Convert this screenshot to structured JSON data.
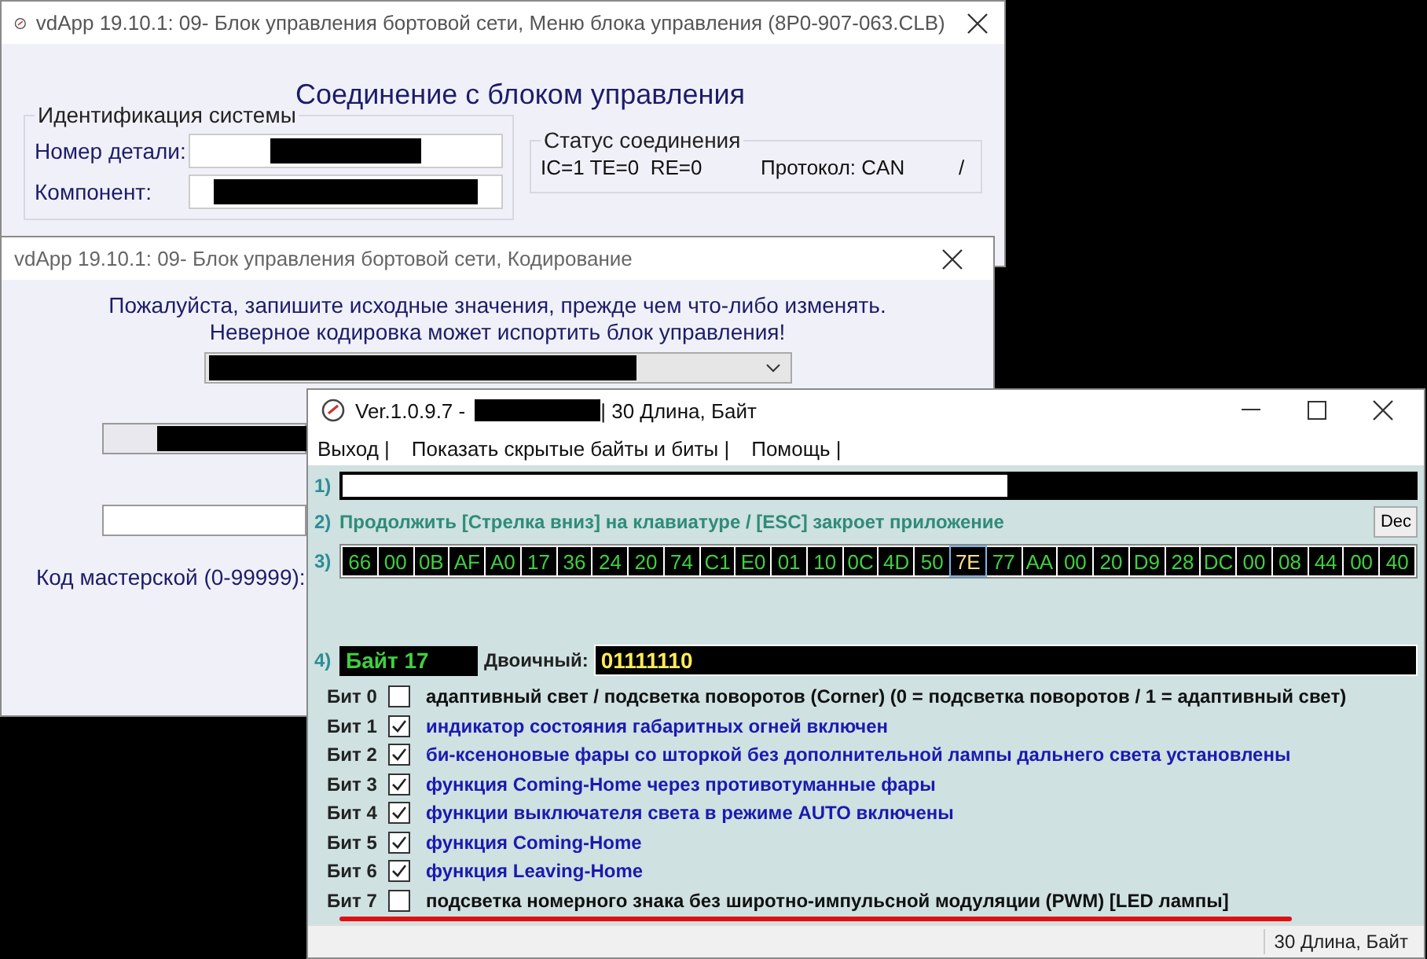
{
  "main_window": {
    "title": "vdApp 19.10.1: 09- Блок управления бортовой сети,  Меню блока управления (8P0-907-063.CLB)",
    "heading": "Соединение с блоком управления",
    "identification": {
      "title": "Идентификация системы",
      "fields": [
        {
          "label": "Номер детали:"
        },
        {
          "label": "Компонент:"
        }
      ]
    },
    "connection_status": {
      "title": "Статус соединения",
      "counters": "IC=1 TE=0  RE=0",
      "protocol": "Протокол: CAN",
      "indicator": "/"
    }
  },
  "coding_window": {
    "title": "vdApp 19.10.1: 09- Блок управления бортовой сети,  Кодирование",
    "notice_lines": [
      "Пожалуйста, запишите исходные значения, прежде чем что-либо изменять.",
      "Неверное кодировка может испортить блок управления!"
    ],
    "workshop_code_label": "Код мастерской (0-99999):"
  },
  "editor_window": {
    "title_prefix": "Ver.1.0.9.7 -",
    "title_suffix": "| 30 Длина, Байт",
    "menu": [
      "Выход |",
      "Показать скрытые байты и биты |",
      "Помощь |"
    ],
    "step_labels": [
      "1)",
      "2)",
      "3)",
      "4)"
    ],
    "hint": "Продолжить [Стрелка вниз] на клавиатуре / [ESC] закроет приложение",
    "dec_button": "Dec",
    "bytes": [
      {
        "value": "66",
        "selected": false
      },
      {
        "value": "00",
        "selected": false
      },
      {
        "value": "0B",
        "selected": false
      },
      {
        "value": "AF",
        "selected": false
      },
      {
        "value": "A0",
        "selected": false
      },
      {
        "value": "17",
        "selected": false
      },
      {
        "value": "36",
        "selected": false
      },
      {
        "value": "24",
        "selected": false
      },
      {
        "value": "20",
        "selected": false
      },
      {
        "value": "74",
        "selected": false
      },
      {
        "value": "C1",
        "selected": false
      },
      {
        "value": "E0",
        "selected": false
      },
      {
        "value": "01",
        "selected": false
      },
      {
        "value": "10",
        "selected": false
      },
      {
        "value": "0C",
        "selected": false
      },
      {
        "value": "4D",
        "selected": false
      },
      {
        "value": "50",
        "selected": false
      },
      {
        "value": "7E",
        "selected": true
      },
      {
        "value": "77",
        "selected": false
      },
      {
        "value": "AA",
        "selected": false
      },
      {
        "value": "00",
        "selected": false
      },
      {
        "value": "20",
        "selected": false
      },
      {
        "value": "D9",
        "selected": false
      },
      {
        "value": "28",
        "selected": false
      },
      {
        "value": "DC",
        "selected": false
      },
      {
        "value": "00",
        "selected": false
      },
      {
        "value": "08",
        "selected": false
      },
      {
        "value": "44",
        "selected": false
      },
      {
        "value": "00",
        "selected": false
      },
      {
        "value": "40",
        "selected": false
      }
    ],
    "byte_label": "Байт 17",
    "binary_label": "Двоичный:",
    "binary_value": "01111110",
    "bits": [
      {
        "label": "Бит 0",
        "checked": false,
        "text": "адаптивный свет / подсветка поворотов (Corner) (0 = подсветка поворотов / **1** = адаптивный свет)"
      },
      {
        "label": "Бит 1",
        "checked": true,
        "text": "индикатор состояния габаритных огней включен"
      },
      {
        "label": "Бит 2",
        "checked": true,
        "text": "би-ксеноновые фары со шторкой без дополнительной лампы дальнего света установлены"
      },
      {
        "label": "Бит 3",
        "checked": true,
        "text": "функция Coming-Home через противотуманные фары"
      },
      {
        "label": "Бит 4",
        "checked": true,
        "text": "функции выключателя света в режиме AUTO включены"
      },
      {
        "label": "Бит 5",
        "checked": true,
        "text": "функция Coming-Home"
      },
      {
        "label": "Бит 6",
        "checked": true,
        "text": "функция Leaving-Home"
      },
      {
        "label": "Бит 7",
        "checked": false,
        "text": "подсветка номерного знака без широтно-импульсной модуляции (PWM) [LED лампы]"
      }
    ],
    "status_bar": "30 Длина, Байт"
  }
}
